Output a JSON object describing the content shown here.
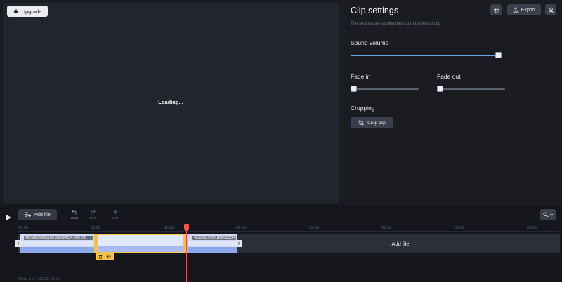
{
  "preview": {
    "upgrade_label": "Upgrade",
    "loading_text": "Loading..."
  },
  "settings": {
    "title": "Clip settings",
    "subtitle": "The settings are applied only to the selected clip",
    "export_label": "Export",
    "sound_volume_label": "Sound volume",
    "sound_volume_value": 1.0,
    "fade_in_label": "Fade in",
    "fade_in_value": 0,
    "fade_out_label": "Fade out",
    "fade_out_value": 0,
    "cropping_label": "Cropping",
    "crop_clip_label": "Crop clip"
  },
  "timeline": {
    "add_file_label": "Add file",
    "undo_label": "Undo",
    "redo_label": "Redo",
    "split_label": "Split",
    "ticks": [
      "00:00",
      "00:30",
      "01:00",
      "01:30",
      "02:00",
      "02:30",
      "03:00",
      "03:30"
    ],
    "clip1_name": "4835dd25feb61b80aa3ce4c5474b7ef8",
    "clip2_name": "4835dd25feb61b80aa3ce4c5474b7ef8",
    "add_file_track_label": "Add file",
    "movie_time_text": "Movie time – 01:33 / 01:38"
  },
  "colors": {
    "accent": "#6ea8ea",
    "selection": "#f2c14b",
    "playhead": "#e85a50"
  }
}
